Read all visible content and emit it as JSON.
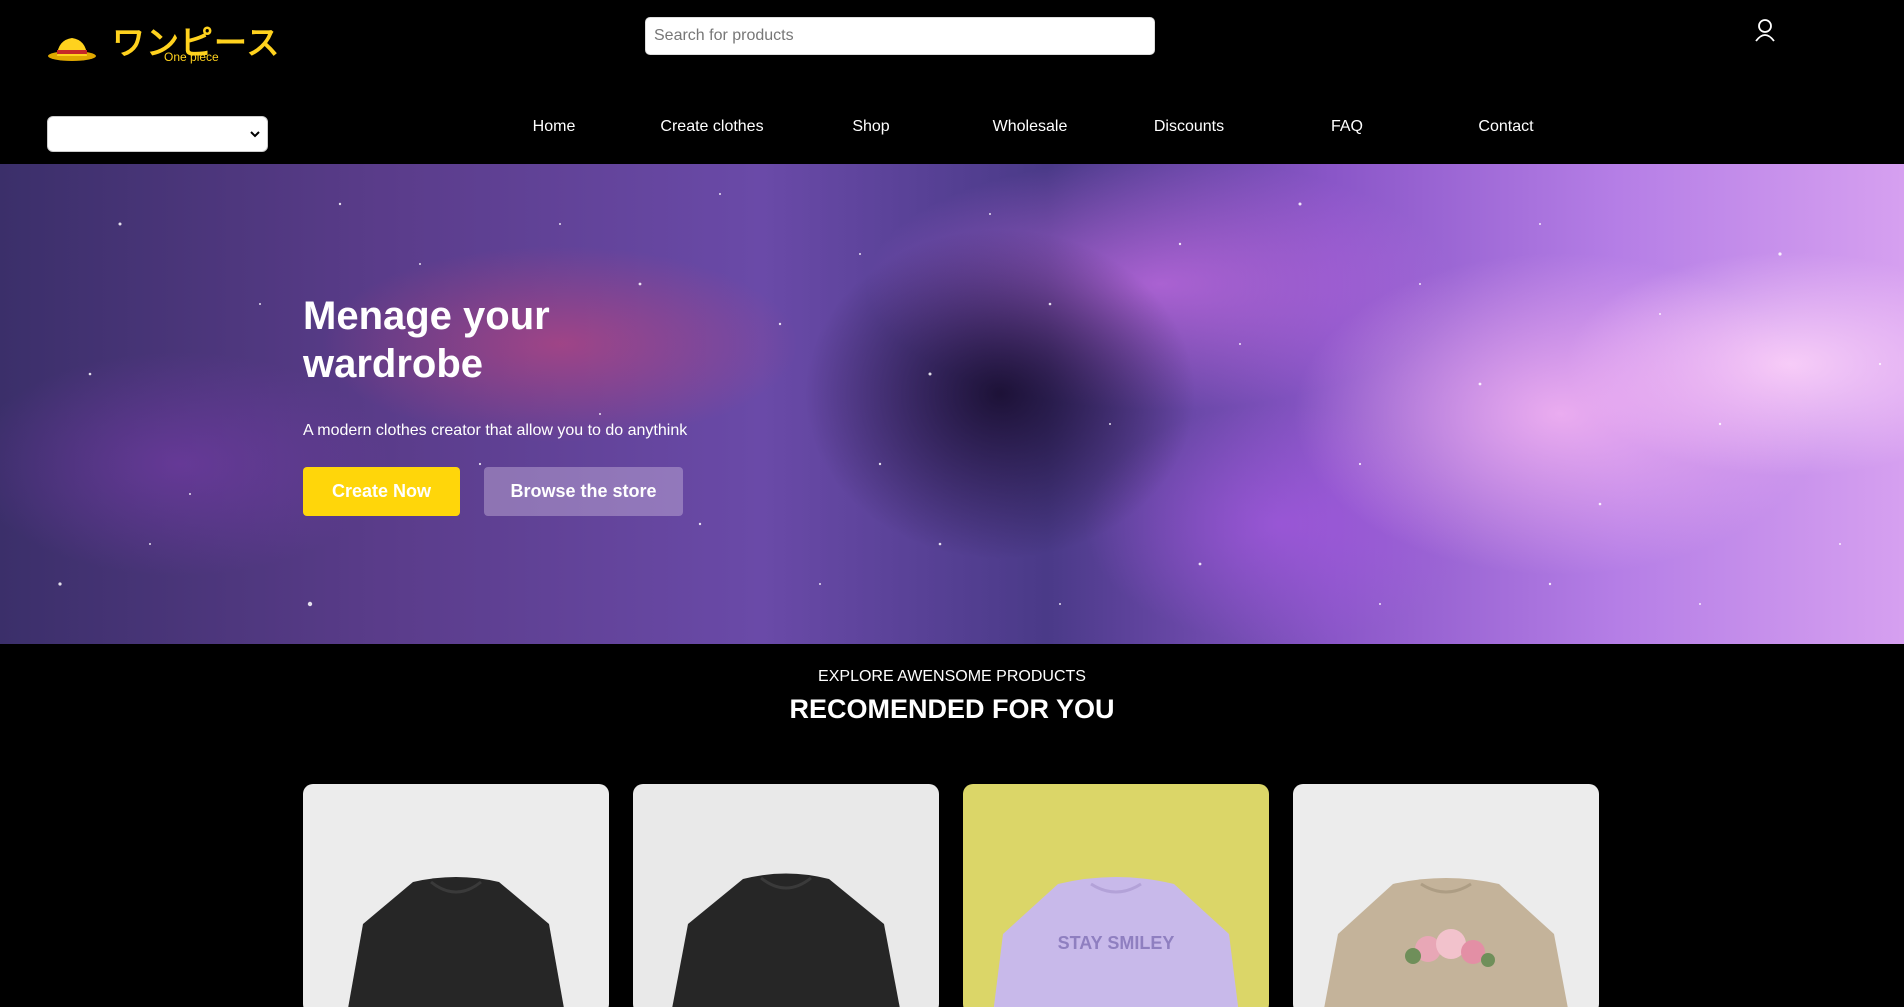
{
  "header": {
    "logo_jp": "ワンピース",
    "logo_en": "One piece",
    "search_placeholder": "Search for products",
    "language_selected": ""
  },
  "nav": {
    "items": [
      "Home",
      "Create clothes",
      "Shop",
      "Wholesale",
      "Discounts",
      "FAQ",
      "Contact"
    ]
  },
  "hero": {
    "title": "Menage your wardrobe",
    "subtitle": "A modern clothes creator that allow you to do anythink",
    "primary_button": "Create Now",
    "secondary_button": "Browse the store"
  },
  "products": {
    "kicker": "EXPLORE AWENSOME PRODUCTS",
    "title": "RECOMENDED FOR YOU",
    "cards": [
      {
        "shirt_color": "#262626",
        "background": "#ececec"
      },
      {
        "shirt_color": "#262626",
        "background": "#e9e9e9"
      },
      {
        "shirt_color": "#c8b9ea",
        "background": "#dbd668",
        "print_text": "STAY SMILEY"
      },
      {
        "shirt_color": "#c4b39a",
        "background": "#ececec",
        "print": "flowers"
      }
    ]
  },
  "colors": {
    "accent": "#ffd60a",
    "background": "#000000"
  }
}
